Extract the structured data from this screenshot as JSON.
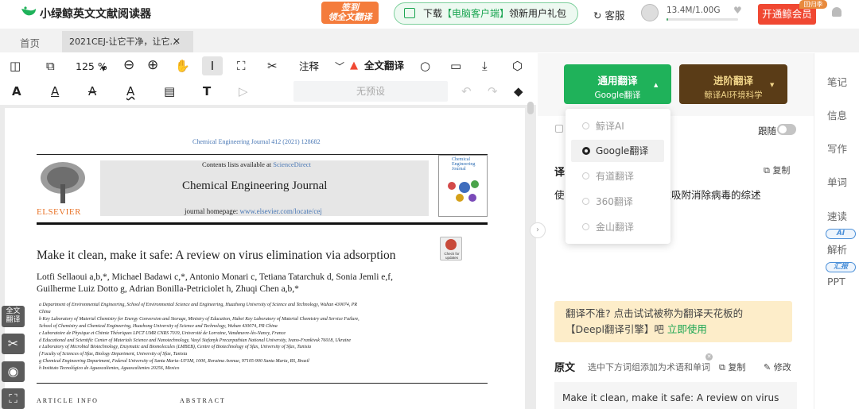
{
  "app": {
    "title": "小绿鲸英文文献阅读器"
  },
  "header": {
    "signin_line1": "签到",
    "signin_line2": "领全文翻译",
    "download_prefix": "下载",
    "download_highlight": "【电脑客户端】",
    "download_suffix": "领新用户礼包",
    "customer_service": "客服",
    "storage": "13.4M/1.00G",
    "storage_fraction": 0.013,
    "vip_button": "开通鲸会员",
    "back_badge": "回归季"
  },
  "tabs": {
    "home": "首页",
    "doc": "2021CEJ-让它干净，让它..."
  },
  "toolbar": {
    "zoom": "125 %",
    "annotation": "注释",
    "full_translate": "全文翻译",
    "preset": "无预设"
  },
  "document": {
    "journal_ref": "Chemical Engineering Journal 412 (2021) 128682",
    "contents_prefix": "Contents lists available at ",
    "contents_link": "ScienceDirect",
    "journal_name": "Chemical Engineering Journal",
    "homepage_prefix": "journal homepage: ",
    "homepage_link": "www.elsevier.com/locate/cej",
    "publisher": "ELSEVIER",
    "cover_title": "Chemical Engineering Journal",
    "check_updates": "Check for updates",
    "title": "Make it clean, make it safe: A review on virus elimination via adsorption",
    "authors_line1": "Lotfi Sellaoui a,b,*, Michael Badawi c,*, Antonio Monari c, Tetiana Tatarchuk d, Sonia Jemli e,f,",
    "authors_line2": "Guilherme Luiz Dotto g, Adrian Bonilla-Petriciolet h, Zhuqi Chen a,b,*",
    "affiliations": [
      "a Department of Environmental Engineering, School of Environmental Science and Engineering, Huazhong University of Science and Technology, Wuhan 430074, PR",
      "China",
      "b Key Laboratory of Material Chemistry for Energy Conversion and Storage, Ministry of Education, Hubei Key Laboratory of Material Chemistry and Service Failure,",
      "School of Chemistry and Chemical Engineering, Huazhong University of Science and Technology, Wuhan 430074, PR China",
      "c Laboratoire de Physique et Chimie Théoriques LPCT UMR CNRS 7019, Université de Lorraine, Vandœuvre-lès-Nancy, France",
      "d Educational and Scientific Center of Materials Science and Nanotechnology, Vasyl Stefanyk Precarpathian National University, Ivano-Frankivsk 76018, Ukraine",
      "e Laboratory of Microbial Biotechnology, Enzymatic and Biomolecules (LMBEB), Centre of Biotechnology of Sfax, University of Sfax, Tunisia",
      "f Faculty of Sciences of Sfax, Biology Department, University of Sfax, Tunisia",
      "g Chemical Engineering Department, Federal University of Santa Maria–UFSM, 1000, Roraima Avenue, 97105-900 Santa Maria, RS, Brazil",
      "h Instituto Tecnológico de Aguascalientes, Aguascalientes 20256, Mexico"
    ],
    "article_info": "ARTICLE INFO",
    "abstract": "ABSTRACT"
  },
  "float_tools": {
    "full_translate_l1": "全文",
    "full_translate_l2": "翻译"
  },
  "panel": {
    "general_translate": "通用翻译",
    "general_engine": "Google翻译",
    "advanced_translate": "进阶翻译",
    "advanced_engine": "鲸译AI环境科学",
    "follow": "跟随",
    "translation_label": "译",
    "copy": "复制",
    "translation_text": "使",
    "translation_text_tail": "过吸附消除病毒的综述",
    "engines": [
      "鲸译AI",
      "Google翻译",
      "有道翻译",
      "360翻译",
      "金山翻译"
    ],
    "selected_engine_index": 1,
    "banner_text": "翻译不准? 点击试试被称为翻译天花板的【Deepl翻译引擎】吧 ",
    "banner_link": "立即使用",
    "original_label": "原文",
    "original_hint": "选中下方词组添加为术语和单词",
    "edit": "修改",
    "original_text": "Make it clean, make it safe: A review on virus elimination via adsorption"
  },
  "sidebar": {
    "items": [
      "笔记",
      "信息",
      "写作",
      "单词",
      "速读",
      "解析",
      "PPT"
    ],
    "ai_badge": "AI",
    "report_badge": "汇报"
  },
  "colors": {
    "brand_green": "#1fb25a",
    "vip_red": "#f04832",
    "advanced_brown": "#5a3c17",
    "banner_yellow": "#fdedc9"
  }
}
